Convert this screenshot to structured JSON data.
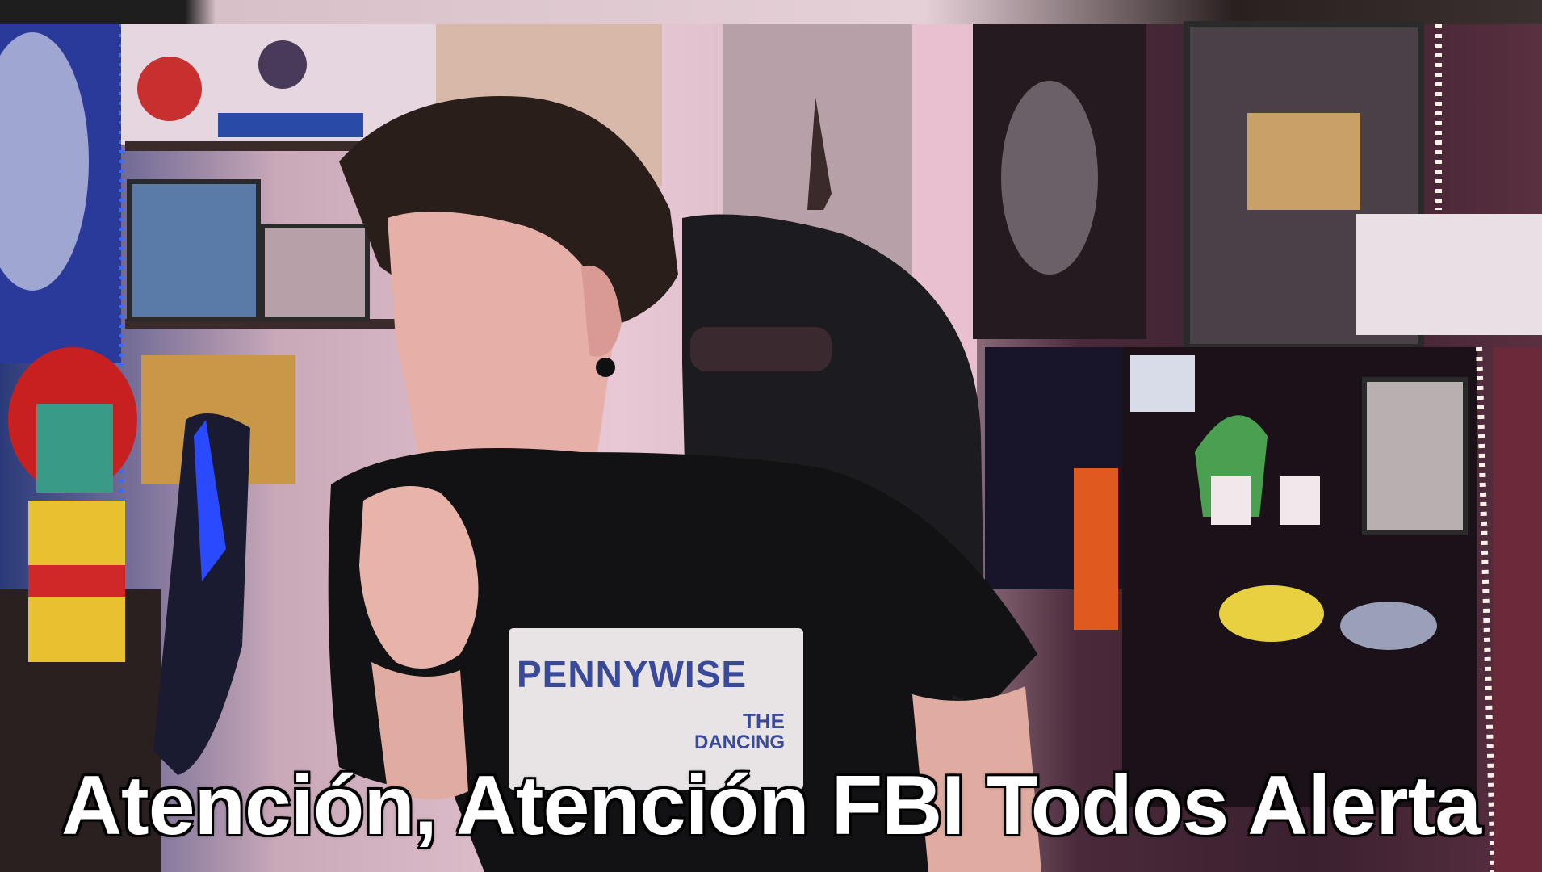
{
  "subtitle": {
    "text": "Atención, Atención FBI Todos Alerta",
    "color": "#ffffff",
    "outline_color": "#000000"
  },
  "shirt": {
    "title": "PENNYWISE",
    "line1": "THE",
    "line2": "DANCING"
  },
  "palette": {
    "wall_pink": "#e8c8d4",
    "led_blue": "#2a5aff",
    "shirt_black": "#121214",
    "chair_black": "#1c1c20"
  }
}
